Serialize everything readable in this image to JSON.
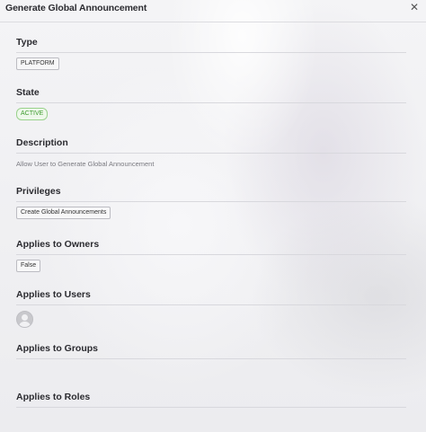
{
  "dialog": {
    "title": "Generate Global Announcement",
    "close_icon": "close-icon"
  },
  "sections": {
    "type": {
      "label": "Type",
      "value": "PLATFORM"
    },
    "state": {
      "label": "State",
      "value": "ACTIVE",
      "color": "#3c9a2c"
    },
    "description": {
      "label": "Description",
      "value": "Allow User to Generate Global Announcement"
    },
    "privileges": {
      "label": "Privileges",
      "items": [
        "Create Global Announcements"
      ]
    },
    "owners": {
      "label": "Applies to Owners",
      "value": "False"
    },
    "users": {
      "label": "Applies to Users",
      "avatar_icon": "user-avatar-icon"
    },
    "groups": {
      "label": "Applies to Groups"
    },
    "roles": {
      "label": "Applies to Roles"
    }
  }
}
